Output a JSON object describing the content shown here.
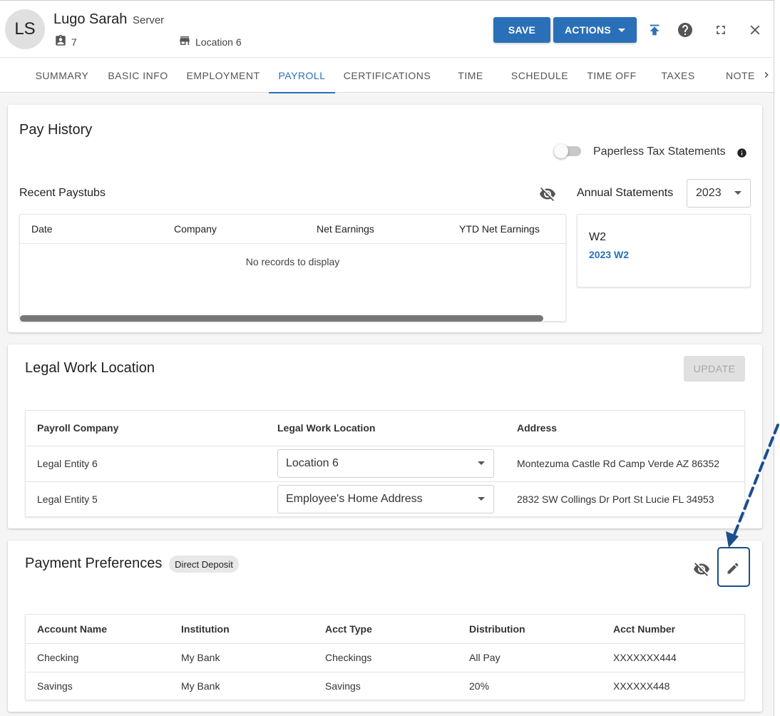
{
  "employee": {
    "initials": "LS",
    "name": "Lugo Sarah",
    "role": "Server",
    "id_number": "7",
    "location": "Location 6"
  },
  "header": {
    "save_label": "SAVE",
    "actions_label": "ACTIONS"
  },
  "tabs": [
    {
      "label": "SUMMARY"
    },
    {
      "label": "BASIC INFO"
    },
    {
      "label": "EMPLOYMENT"
    },
    {
      "label": "PAYROLL"
    },
    {
      "label": "CERTIFICATIONS"
    },
    {
      "label": "TIME"
    },
    {
      "label": "SCHEDULE"
    },
    {
      "label": "TIME OFF"
    },
    {
      "label": "TAXES"
    },
    {
      "label": "NOTE"
    }
  ],
  "active_tab": "PAYROLL",
  "pay_history": {
    "title": "Pay History",
    "paperless_label": "Paperless Tax Statements",
    "paperless_enabled": false,
    "recent_paystubs_label": "Recent Paystubs",
    "columns": [
      "Date",
      "Company",
      "Net Earnings",
      "YTD Net Earnings"
    ],
    "empty_message": "No records to display",
    "annual_statements_label": "Annual Statements",
    "year": "2023",
    "statement": {
      "type": "W2",
      "link": "2023 W2"
    }
  },
  "legal_work_location": {
    "title": "Legal Work Location",
    "update_label": "UPDATE",
    "columns": [
      "Payroll Company",
      "Legal Work Location",
      "Address"
    ],
    "rows": [
      {
        "company": "Legal Entity 6",
        "location": "Location 6",
        "address": "Montezuma Castle Rd Camp Verde AZ 86352"
      },
      {
        "company": "Legal Entity 5",
        "location": "Employee's Home Address",
        "address": "2832 SW Collings Dr Port St Lucie FL 34953"
      }
    ]
  },
  "payment_preferences": {
    "title": "Payment Preferences",
    "badge": "Direct Deposit",
    "columns": [
      "Account Name",
      "Institution",
      "Acct Type",
      "Distribution",
      "Acct Number"
    ],
    "rows": [
      {
        "account_name": "Checking",
        "institution": "My Bank",
        "acct_type": "Checkings",
        "distribution": "All Pay",
        "acct_number": "XXXXXXX444"
      },
      {
        "account_name": "Savings",
        "institution": "My Bank",
        "acct_type": "Savings",
        "distribution": "20%",
        "acct_number": "XXXXXX448"
      }
    ]
  },
  "colors": {
    "accent": "#2a70b8",
    "annotation": "#1a4e8c"
  },
  "icons": {
    "id": "badge-icon",
    "location": "store-icon",
    "upload": "upload-icon",
    "help": "help-icon",
    "fullscreen": "fullscreen-icon",
    "close": "close-icon",
    "visibility_off": "visibility-off-icon",
    "info": "info-icon",
    "edit": "pencil-icon"
  }
}
